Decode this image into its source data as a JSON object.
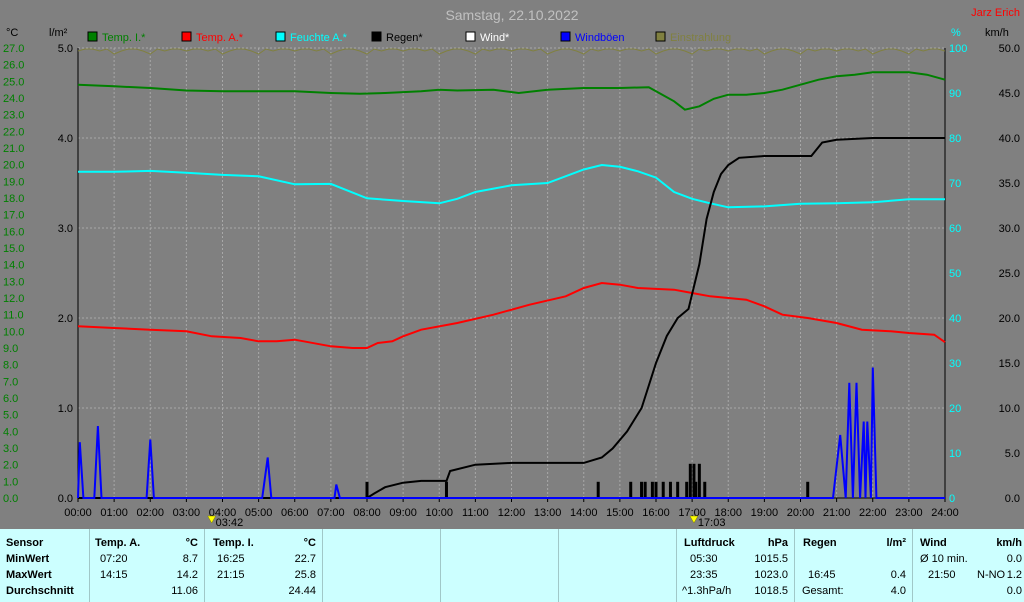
{
  "header": {
    "title": "Samstag, 22.10.2022",
    "credit": "Jarz Erich",
    "unit_left_1": "°C",
    "unit_left_2": "l/m²",
    "unit_right_1": "%",
    "unit_right_2": "km/h"
  },
  "legend": [
    {
      "label": "Temp. I.*",
      "color": "#008000"
    },
    {
      "label": "Temp. A.*",
      "color": "#ff0000"
    },
    {
      "label": "Feuchte A.*",
      "color": "#00ffff"
    },
    {
      "label": "Regen*",
      "color": "#000000"
    },
    {
      "label": "Wind*",
      "color": "#ffffff"
    },
    {
      "label": "Windböen",
      "color": "#0000ff"
    },
    {
      "label": "Einstrahlung",
      "color": "#808040"
    }
  ],
  "markers": [
    {
      "label": "03:42",
      "time": 3.7
    },
    {
      "label": "17:03",
      "time": 17.05
    }
  ],
  "chart_data": {
    "type": "line",
    "x_ticks": [
      "00:00",
      "01:00",
      "02:00",
      "03:00",
      "04:00",
      "05:00",
      "06:00",
      "07:00",
      "08:00",
      "09:00",
      "10:00",
      "11:00",
      "12:00",
      "13:00",
      "14:00",
      "15:00",
      "16:00",
      "17:00",
      "18:00",
      "19:00",
      "20:00",
      "21:00",
      "22:00",
      "23:00",
      "24:00"
    ],
    "temp_axis": {
      "ticks": [
        "27.0",
        "26.0",
        "25.0",
        "24.0",
        "23.0",
        "22.0",
        "21.0",
        "20.0",
        "19.0",
        "18.0",
        "17.0",
        "16.0",
        "15.0",
        "14.0",
        "13.0",
        "12.0",
        "11.0",
        "10.0",
        "9.0",
        "8.0",
        "7.0",
        "6.0",
        "5.0",
        "4.0",
        "3.0",
        "2.0",
        "1.0",
        "0.0"
      ],
      "range": [
        0,
        27
      ]
    },
    "rain_axis": {
      "ticks": [
        "5.0",
        "4.0",
        "3.0",
        "2.0",
        "1.0",
        "0.0"
      ],
      "range": [
        0,
        5
      ]
    },
    "humidity_axis": {
      "ticks": [
        "100",
        "90",
        "80",
        "70",
        "60",
        "50",
        "40",
        "30",
        "20",
        "10",
        "0"
      ],
      "range": [
        0,
        100
      ]
    },
    "wind_axis": {
      "ticks": [
        "50.0",
        "45.0",
        "40.0",
        "35.0",
        "30.0",
        "25.0",
        "20.0",
        "15.0",
        "10.0",
        "5.0",
        "0.0"
      ],
      "range": [
        0,
        50
      ]
    },
    "series": [
      {
        "name": "Temp. I.*",
        "color": "#008000",
        "axis": "temp",
        "points": [
          [
            0,
            24.8
          ],
          [
            1,
            24.7
          ],
          [
            2,
            24.6
          ],
          [
            3,
            24.45
          ],
          [
            4,
            24.4
          ],
          [
            5,
            24.4
          ],
          [
            6,
            24.4
          ],
          [
            7,
            24.3
          ],
          [
            7.8,
            24.25
          ],
          [
            8.5,
            24.3
          ],
          [
            9.5,
            24.4
          ],
          [
            10,
            24.5
          ],
          [
            10.5,
            24.45
          ],
          [
            11.5,
            24.5
          ],
          [
            12.2,
            24.3
          ],
          [
            13,
            24.5
          ],
          [
            14,
            24.6
          ],
          [
            15,
            24.6
          ],
          [
            15.8,
            24.65
          ],
          [
            16,
            24.4
          ],
          [
            16.5,
            23.8
          ],
          [
            16.8,
            23.3
          ],
          [
            17.2,
            23.5
          ],
          [
            17.6,
            23.95
          ],
          [
            18,
            24.2
          ],
          [
            18.5,
            24.2
          ],
          [
            19,
            24.3
          ],
          [
            19.5,
            24.5
          ],
          [
            20,
            24.8
          ],
          [
            20.5,
            25.1
          ],
          [
            21,
            25.3
          ],
          [
            21.5,
            25.4
          ],
          [
            22,
            25.55
          ],
          [
            23,
            25.55
          ],
          [
            23.5,
            25.4
          ],
          [
            24,
            25.1
          ]
        ]
      },
      {
        "name": "Temp. A.*",
        "color": "#ff0000",
        "axis": "temp",
        "points": [
          [
            0,
            10.3
          ],
          [
            1,
            10.2
          ],
          [
            2,
            10.1
          ],
          [
            3,
            10.0
          ],
          [
            3.7,
            9.7
          ],
          [
            4.5,
            9.6
          ],
          [
            5,
            9.4
          ],
          [
            5.5,
            9.4
          ],
          [
            6,
            9.5
          ],
          [
            7,
            9.1
          ],
          [
            7.6,
            9.0
          ],
          [
            8,
            9.0
          ],
          [
            8.3,
            9.3
          ],
          [
            8.7,
            9.4
          ],
          [
            9,
            9.7
          ],
          [
            9.5,
            10.1
          ],
          [
            10.5,
            10.5
          ],
          [
            11.5,
            11.0
          ],
          [
            12.5,
            11.6
          ],
          [
            13.5,
            12.1
          ],
          [
            14,
            12.6
          ],
          [
            14.5,
            12.9
          ],
          [
            15,
            12.8
          ],
          [
            15.5,
            12.6
          ],
          [
            16.5,
            12.5
          ],
          [
            17,
            12.3
          ],
          [
            17.5,
            12.1
          ],
          [
            18.5,
            11.9
          ],
          [
            19,
            11.5
          ],
          [
            19.5,
            11.0
          ],
          [
            20.2,
            10.8
          ],
          [
            21,
            10.5
          ],
          [
            21.7,
            10.1
          ],
          [
            22.5,
            10.0
          ],
          [
            23,
            9.9
          ],
          [
            23.7,
            9.8
          ],
          [
            24,
            9.35
          ]
        ]
      },
      {
        "name": "Feuchte A.*",
        "color": "#00ffff",
        "axis": "humidity",
        "points": [
          [
            0,
            72.5
          ],
          [
            1,
            72.5
          ],
          [
            2,
            72.7
          ],
          [
            3,
            72.3
          ],
          [
            4,
            71.8
          ],
          [
            5,
            71.5
          ],
          [
            6,
            69.7
          ],
          [
            7,
            69.8
          ],
          [
            8,
            66.6
          ],
          [
            9,
            66.0
          ],
          [
            10,
            65.5
          ],
          [
            10.5,
            66.5
          ],
          [
            11,
            68.0
          ],
          [
            12,
            69.5
          ],
          [
            13,
            70.0
          ],
          [
            14,
            73.0
          ],
          [
            14.5,
            74.0
          ],
          [
            15,
            73.6
          ],
          [
            15.5,
            72.6
          ],
          [
            16,
            71.2
          ],
          [
            16.5,
            68.0
          ],
          [
            17,
            66.5
          ],
          [
            17.5,
            65.5
          ],
          [
            18,
            64.6
          ],
          [
            19,
            64.8
          ],
          [
            20,
            65.4
          ],
          [
            21,
            65.5
          ],
          [
            22,
            65.7
          ],
          [
            23,
            66.4
          ],
          [
            24,
            66.4
          ]
        ]
      },
      {
        "name": "Regen*",
        "color": "#000000",
        "axis": "rain",
        "points": [
          [
            0,
            0.0
          ],
          [
            8.0,
            0.0
          ],
          [
            8.2,
            0.05
          ],
          [
            8.5,
            0.12
          ],
          [
            9,
            0.17
          ],
          [
            9.5,
            0.19
          ],
          [
            10.2,
            0.19
          ],
          [
            10.3,
            0.3
          ],
          [
            11,
            0.37
          ],
          [
            12,
            0.39
          ],
          [
            13,
            0.39
          ],
          [
            14,
            0.39
          ],
          [
            14.5,
            0.45
          ],
          [
            14.8,
            0.55
          ],
          [
            15.2,
            0.74
          ],
          [
            15.6,
            1.0
          ],
          [
            15.8,
            1.25
          ],
          [
            16,
            1.5
          ],
          [
            16.3,
            1.8
          ],
          [
            16.6,
            2.0
          ],
          [
            16.9,
            2.1
          ],
          [
            17.2,
            2.6
          ],
          [
            17.4,
            3.1
          ],
          [
            17.6,
            3.4
          ],
          [
            17.8,
            3.6
          ],
          [
            18,
            3.7
          ],
          [
            18.3,
            3.78
          ],
          [
            19,
            3.8
          ],
          [
            20,
            3.8
          ],
          [
            20.3,
            3.8
          ],
          [
            20.6,
            3.95
          ],
          [
            21,
            3.98
          ],
          [
            22,
            4.0
          ],
          [
            24,
            4.0
          ]
        ]
      },
      {
        "name": "Windböen",
        "color": "#0000ff",
        "axis": "wind",
        "points": [
          [
            0,
            0
          ],
          [
            0.05,
            6.2
          ],
          [
            0.15,
            0
          ],
          [
            0.45,
            0
          ],
          [
            0.55,
            8.0
          ],
          [
            0.65,
            0
          ],
          [
            1.9,
            0
          ],
          [
            2.0,
            6.5
          ],
          [
            2.1,
            0
          ],
          [
            5.1,
            0
          ],
          [
            5.25,
            4.5
          ],
          [
            5.35,
            0
          ],
          [
            7.1,
            0
          ],
          [
            7.15,
            1.5
          ],
          [
            7.25,
            0
          ],
          [
            20.9,
            0
          ],
          [
            21.1,
            7.0
          ],
          [
            21.25,
            0
          ],
          [
            21.35,
            12.8
          ],
          [
            21.45,
            0
          ],
          [
            21.55,
            12.8
          ],
          [
            21.65,
            0
          ],
          [
            21.75,
            8.5
          ],
          [
            21.8,
            0
          ],
          [
            21.85,
            8.5
          ],
          [
            21.95,
            0
          ],
          [
            22.0,
            14.5
          ],
          [
            22.1,
            0
          ],
          [
            24,
            0
          ]
        ]
      }
    ],
    "rain_bars": [
      8.0,
      10.2,
      14.4,
      15.3,
      15.6,
      15.7,
      15.9,
      16.0,
      16.2,
      16.4,
      16.6,
      16.85,
      16.95,
      17.05,
      17.1,
      17.2,
      17.35,
      20.2
    ],
    "rain_bar_heights": [
      0.18,
      0.18,
      0.18,
      0.18,
      0.18,
      0.18,
      0.18,
      0.18,
      0.18,
      0.18,
      0.18,
      0.18,
      0.38,
      0.38,
      0.18,
      0.38,
      0.18,
      0.18
    ]
  },
  "table": {
    "row_labels": [
      "Sensor",
      "MinWert",
      "MaxWert",
      "Durchschnitt"
    ],
    "temp_a": {
      "head": "Temp. A.",
      "unit": "°C",
      "min_time": "07:20",
      "min": "8.7",
      "max_time": "14:15",
      "max": "14.2",
      "avg": "11.06"
    },
    "temp_i": {
      "head": "Temp. I.",
      "unit": "°C",
      "min_time": "16:25",
      "min": "22.7",
      "max_time": "21:15",
      "max": "25.8",
      "avg": "24.44"
    },
    "pressure": {
      "head": "Luftdruck",
      "unit": "hPa",
      "min_time": "05:30",
      "min": "1015.5",
      "max_time": "23:35",
      "max": "1023.0",
      "trend": "^1.3hPa/h",
      "avg": "1018.5"
    },
    "rain": {
      "head": "Regen",
      "unit": "l/m²",
      "max_time": "16:45",
      "max": "0.4",
      "total_label": "Gesamt:",
      "total": "4.0"
    },
    "wind": {
      "head": "Wind",
      "unit": "km/h",
      "avg_label": "Ø 10 min.",
      "avg": "0.0",
      "max_time": "21:50",
      "max_dir": "N-NO",
      "max": "1.2",
      "avg_day": "0.0"
    }
  }
}
